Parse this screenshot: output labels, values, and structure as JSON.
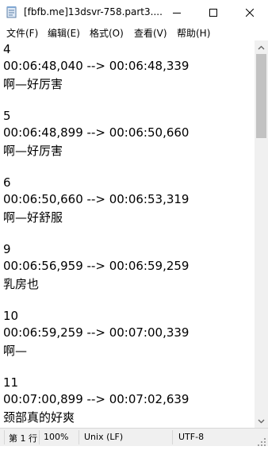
{
  "window": {
    "title": "[fbfb.me]13dsvr-758.part3....",
    "icon": "notepad-icon"
  },
  "menu": {
    "items": [
      "文件(F)",
      "编辑(E)",
      "格式(O)",
      "查看(V)",
      "帮助(H)"
    ]
  },
  "editor": {
    "lines": [
      "4",
      "00:06:48,040 --> 00:06:48,339",
      "啊—好厉害",
      "",
      "5",
      "00:06:48,899 --> 00:06:50,660",
      "啊—好厉害",
      "",
      "6",
      "00:06:50,660 --> 00:06:53,319",
      "啊—好舒服",
      "",
      "9",
      "00:06:56,959 --> 00:06:59,259",
      "乳房也",
      "",
      "10",
      "00:06:59,259 --> 00:07:00,339",
      "啊—",
      "",
      "11",
      "00:07:00,899 --> 00:07:02,639",
      "颈部真的好爽"
    ]
  },
  "statusbar": {
    "position": "第 1 行",
    "zoom": "100%",
    "line_ending": "Unix (LF)",
    "encoding": "UTF-8"
  }
}
